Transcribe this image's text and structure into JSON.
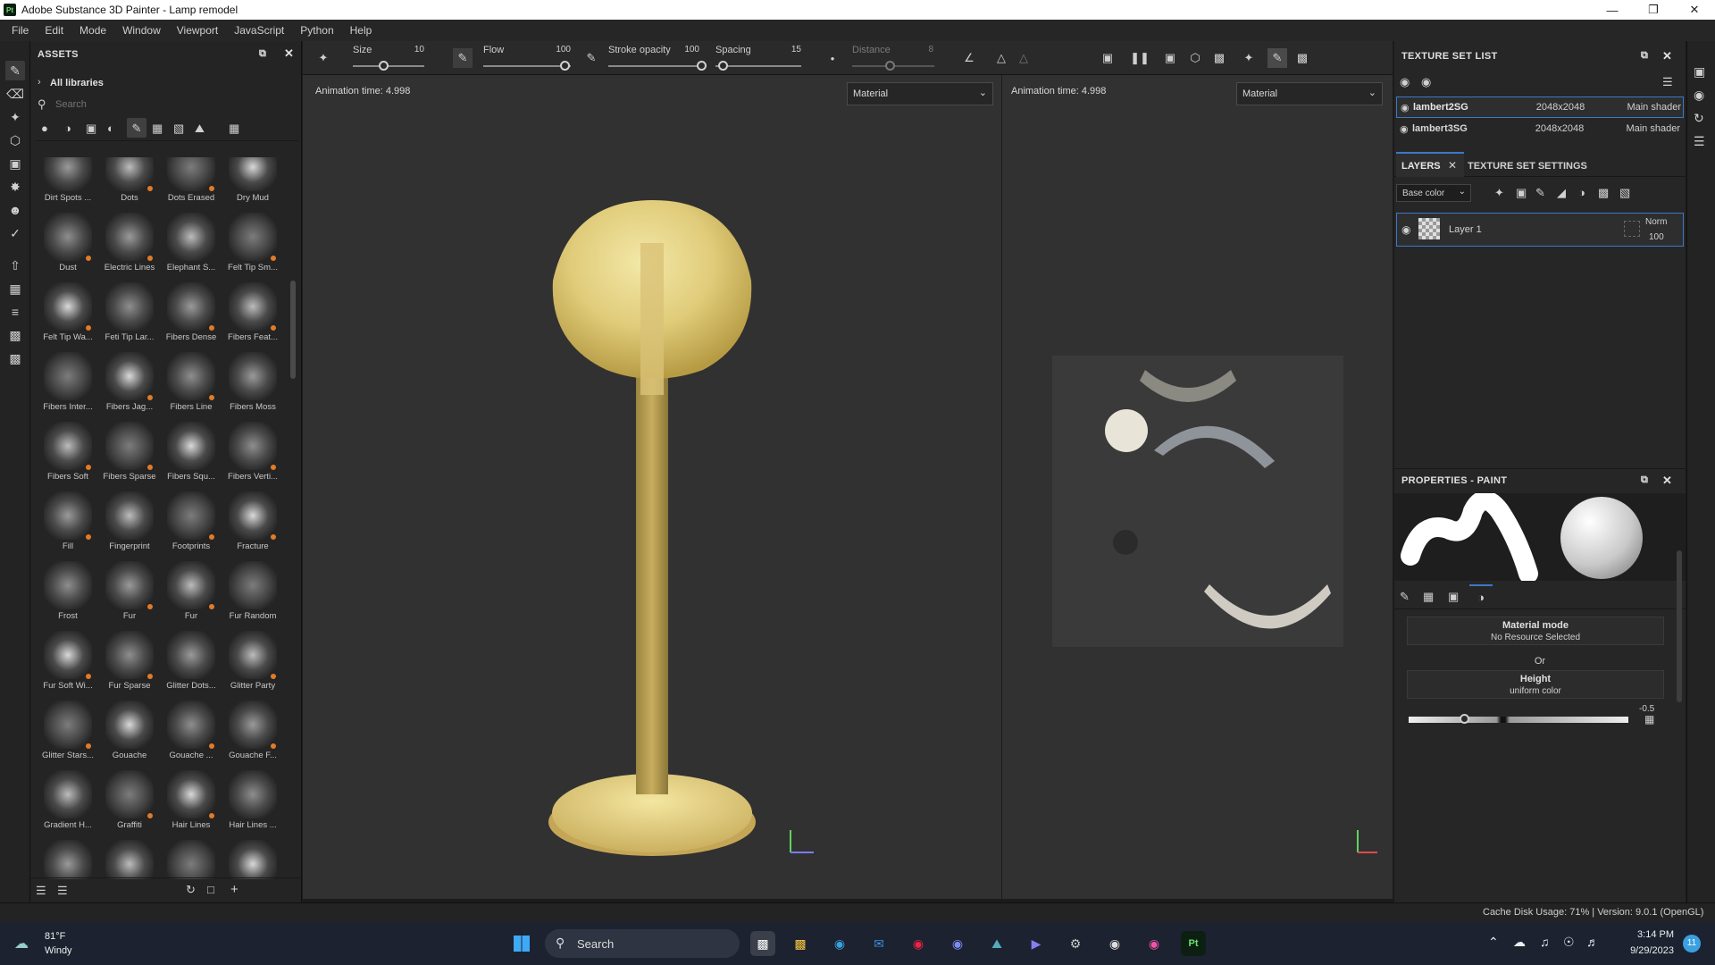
{
  "app": {
    "title": "Adobe Substance 3D Painter - Lamp remodel",
    "logo": "Pt"
  },
  "menu": [
    "File",
    "Edit",
    "Mode",
    "Window",
    "Viewport",
    "JavaScript",
    "Python",
    "Help"
  ],
  "assets": {
    "title": "ASSETS",
    "library": "All libraries",
    "search_placeholder": "Search",
    "brushes": [
      "Dirt Spots ...",
      "Dots",
      "Dots Erased",
      "Dry Mud",
      "Dust",
      "Electric Lines",
      "Elephant S...",
      "Felt Tip Sm...",
      "Felt Tip Wa...",
      "Feti Tip Lar...",
      "Fibers Dense",
      "Fibers Feat...",
      "Fibers Inter...",
      "Fibers Jag...",
      "Fibers Line",
      "Fibers Moss",
      "Fibers Soft",
      "Fibers Sparse",
      "Fibers Squ...",
      "Fibers Verti...",
      "Fill",
      "Fingerprint",
      "Footprints",
      "Fracture",
      "Frost",
      "Fur",
      "Fur",
      "Fur Random",
      "Fur Soft Wi...",
      "Fur Sparse",
      "Glitter Dots...",
      "Glitter Party",
      "Glitter Stars...",
      "Gouache",
      "Gouache ...",
      "Gouache F...",
      "Gradient H...",
      "Graffiti",
      "Hair Lines",
      "Hair Lines ...",
      "",
      "",
      "",
      ""
    ]
  },
  "toolbar": {
    "size_label": "Size",
    "size_value": "10",
    "flow_label": "Flow",
    "flow_value": "100",
    "stroke_label": "Stroke opacity",
    "stroke_value": "100",
    "spacing_label": "Spacing",
    "spacing_value": "15",
    "distance_label": "Distance",
    "distance_value": "8"
  },
  "viewport3d": {
    "anim": "Animation time: 4.998",
    "mode": "Material"
  },
  "viewport2d": {
    "anim": "Animation time: 4.998",
    "mode": "Material"
  },
  "texture_sets": {
    "title": "TEXTURE SET LIST",
    "items": [
      {
        "name": "lambert2SG",
        "res": "2048x2048",
        "shader": "Main shader"
      },
      {
        "name": "lambert3SG",
        "res": "2048x2048",
        "shader": "Main shader"
      }
    ]
  },
  "layers": {
    "tab_layers": "LAYERS",
    "tab_settings": "TEXTURE SET SETTINGS",
    "channel": "Base color",
    "items": [
      {
        "name": "Layer 1",
        "blend": "Norm",
        "opacity": "100"
      }
    ]
  },
  "properties": {
    "title": "PROPERTIES - PAINT",
    "material_mode": "Material mode",
    "no_resource": "No Resource Selected",
    "or": "Or",
    "height": "Height",
    "uniform": "uniform color",
    "height_value": "-0.5"
  },
  "status": {
    "text": "Cache Disk Usage:   71% | Version: 9.0.1 (OpenGL)"
  },
  "taskbar": {
    "temp": "81°F",
    "weather": "Windy",
    "search": "Search",
    "time": "3:14 PM",
    "date": "9/29/2023",
    "notif": "11"
  }
}
